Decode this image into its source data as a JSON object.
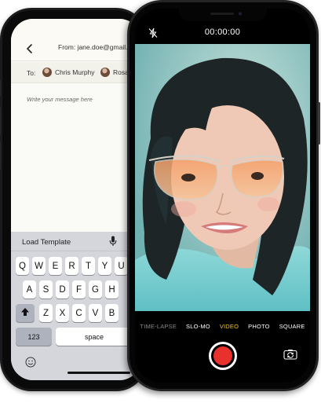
{
  "email": {
    "from_text": "From: jane.doe@gmail.com",
    "to_label": "To:",
    "recipients": [
      {
        "name": "Chris Murphy"
      },
      {
        "name": "Rosa"
      }
    ],
    "message_placeholder": "Write your message here"
  },
  "keyboard": {
    "toolbar_label": "Load Template",
    "row1": [
      "Q",
      "W",
      "E",
      "R",
      "T",
      "Y",
      "U"
    ],
    "row2": [
      "A",
      "S",
      "D",
      "F",
      "G",
      "H"
    ],
    "row3": [
      "Z",
      "X",
      "C",
      "V",
      "B"
    ],
    "numbers_key": "123",
    "space_key": "space"
  },
  "camera": {
    "timer": "00:00:00",
    "modes": [
      "TIME-LAPSE",
      "SLO-MO",
      "VIDEO",
      "PHOTO",
      "SQUARE"
    ],
    "active_mode": "VIDEO",
    "shutter_color": "#e8302d",
    "active_mode_color": "#f4c430"
  },
  "icons": [
    "back-icon",
    "mic-icon",
    "shift-icon",
    "emoji-icon",
    "flash-off-icon",
    "switch-camera-icon"
  ]
}
